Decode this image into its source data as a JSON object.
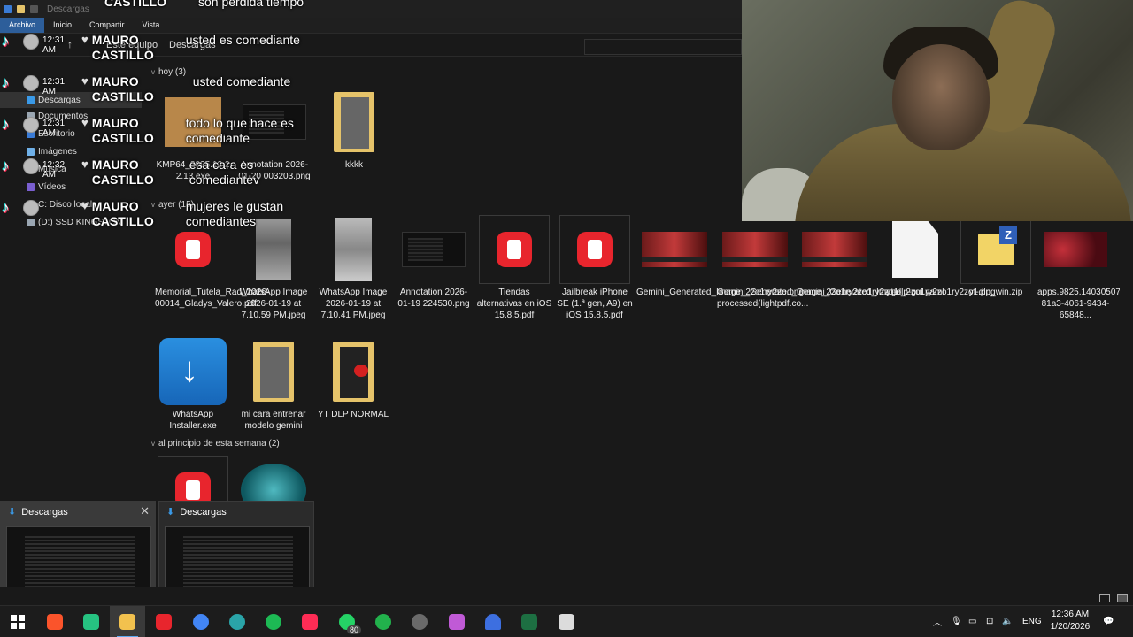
{
  "window": {
    "title": "Descargas",
    "ribbon_tabs": [
      "Archivo",
      "Inicio",
      "Compartir",
      "Vista"
    ],
    "address": [
      "Este equipo",
      "Descargas"
    ]
  },
  "nav": {
    "items": [
      {
        "label": "Descargas",
        "icon": "download-icon",
        "color": "#3a9ae8"
      },
      {
        "label": "Documentos",
        "icon": "documents-icon",
        "color": "#9aa6b2"
      },
      {
        "label": "Escritorio",
        "icon": "desktop-icon",
        "color": "#3a7bd5"
      },
      {
        "label": "Imágenes",
        "icon": "pictures-icon",
        "color": "#6fb0e8"
      },
      {
        "label": "Música",
        "icon": "music-icon",
        "color": "#e07a30"
      },
      {
        "label": "Vídeos",
        "icon": "videos-icon",
        "color": "#7a5fd0"
      },
      {
        "label": "C: Disco local",
        "icon": "drive-icon",
        "color": "#9aa6b2"
      },
      {
        "label": "(D:) SSD KINGSTON",
        "icon": "drive-icon",
        "color": "#9aa6b2"
      }
    ]
  },
  "groups": {
    "today": "hoy (3)",
    "yesterday": "ayer (15)",
    "week": "al principio de esta semana (2)"
  },
  "files_today": [
    {
      "name": "KMP64_2025.12.2 2.13.exe",
      "kind": "package"
    },
    {
      "name": "Annotation 2026-01-20 003203.png",
      "kind": "shot"
    },
    {
      "name": "kkkk",
      "kind": "folder"
    }
  ],
  "files_yesterday": [
    {
      "name": "Memorial_Tutela_Rad_2026-00014_Gladys_Valero.pdf",
      "kind": "pdf"
    },
    {
      "name": "WhatsApp Image 2026-01-19 at 7.10.59 PM.jpeg",
      "kind": "photo"
    },
    {
      "name": "WhatsApp Image 2026-01-19 at 7.10.41 PM.jpeg",
      "kind": "photo2"
    },
    {
      "name": "Annotation 2026-01-19 224530.png",
      "kind": "shot"
    },
    {
      "name": "Tiendas alternativas en iOS 15.8.5.pdf",
      "kind": "pdf"
    },
    {
      "name": "Jailbreak iPhone SE (1.ª gen, A9) en iOS 15.8.5.pdf",
      "kind": "pdf"
    },
    {
      "name": "Gemini_Generated_Image_2zo1ry2zo.png",
      "kind": "gem"
    },
    {
      "name": "Gemini_Generated_Image_2zo1ry2zo1ry2zo1-processed(lightpdf.co...",
      "kind": "gem"
    },
    {
      "name": "Gemini_Generated_Image_2zo1ry2zo1ry2zo1.png",
      "kind": "gem"
    },
    {
      "name": "yt-dlp-gui.yaml",
      "kind": "doc"
    },
    {
      "name": "yt-dlp_win.zip",
      "kind": "zip"
    },
    {
      "name": "apps.9825.14030507256335121.0bde14a7-81a3-4061-9434-65848...",
      "kind": "apps"
    },
    {
      "name": "WhatsApp Installer.exe",
      "kind": "installer"
    },
    {
      "name": "mi cara entrenar modelo gemini",
      "kind": "folder"
    },
    {
      "name": "YT DLP NORMAL",
      "kind": "folder-red"
    }
  ],
  "tiktok": [
    {
      "time": "12:31 AM",
      "user": "MAURO CASTILLO",
      "msg": "usted es comediante"
    },
    {
      "time": "12:31 AM",
      "user": "MAURO CASTILLO",
      "msg": "usted comediante"
    },
    {
      "time": "12:31 AM",
      "user": "MAURO CASTILLO",
      "msg": "todo lo que hace es comediante"
    },
    {
      "time": "12:32 AM",
      "user": "MAURO CASTILLO",
      "msg": "esa cara es comediantev"
    },
    {
      "time": "12:32 AM",
      "user": "MAURO CASTILLO",
      "msg": "mujeres le gustan comediantes"
    }
  ],
  "tiktok_top": {
    "user": "CASTILLO",
    "msg": "son perdida tiempo"
  },
  "previews": [
    {
      "title": "Descargas"
    },
    {
      "title": "Descargas"
    }
  ],
  "taskbar": {
    "apps": [
      {
        "name": "brave-icon",
        "color": "#fb542b"
      },
      {
        "name": "sync-icon",
        "color": "#26c281"
      },
      {
        "name": "file-explorer-icon",
        "color": "#f2c14e"
      },
      {
        "name": "pdf-reader-icon",
        "color": "#e8252d"
      },
      {
        "name": "chrome-icon",
        "color": "#4285f4"
      },
      {
        "name": "browser-icon",
        "color": "#2aa4a8"
      },
      {
        "name": "spotify-icon",
        "color": "#1db954"
      },
      {
        "name": "tiktok-icon",
        "color": "#fe2c55"
      },
      {
        "name": "whatsapp-icon",
        "color": "#25d366",
        "badge": "80"
      },
      {
        "name": "download-manager-icon",
        "color": "#22b14c"
      },
      {
        "name": "obs-icon",
        "color": "#6a6a6a"
      },
      {
        "name": "photos-icon",
        "color": "#c05ad6"
      },
      {
        "name": "arc-icon",
        "color": "#3d6fe0"
      },
      {
        "name": "excel-icon",
        "color": "#1d6f42"
      },
      {
        "name": "notepad-icon",
        "color": "#dcdcdc"
      }
    ],
    "lang": "ENG",
    "time": "12:36 AM",
    "date": "1/20/2026"
  }
}
